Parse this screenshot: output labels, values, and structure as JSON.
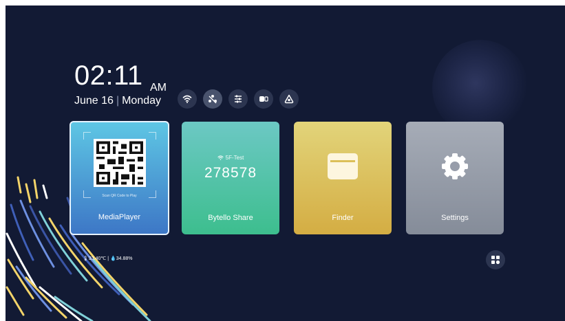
{
  "clock": {
    "time": "02:11",
    "ampm": "AM"
  },
  "date": {
    "day": "June 16",
    "weekday": "Monday"
  },
  "status_icons": [
    "wifi-icon",
    "network-share-icon",
    "sliders-icon",
    "display-mode-icon",
    "cloud-icon"
  ],
  "tiles": [
    {
      "label": "MediaPlayer",
      "caption": "Scan QR Code to Play",
      "colors": [
        "#5ec6e4",
        "#3d77c6"
      ]
    },
    {
      "label": "Bytello Share",
      "network": "5F-Test",
      "code": "278578",
      "colors": [
        "#6cc8c4",
        "#3dbe8e"
      ]
    },
    {
      "label": "Finder",
      "colors": [
        "#e2d47a",
        "#d4ad43"
      ]
    },
    {
      "label": "Settings",
      "colors": [
        "#a6acb7",
        "#858c99"
      ]
    }
  ],
  "sensors": {
    "temperature": "33.40℃",
    "separator": "|",
    "humidity": "34.88%"
  },
  "apps_button": {
    "icon": "apps-grid-icon"
  },
  "colors": {
    "background": "#121a34"
  }
}
